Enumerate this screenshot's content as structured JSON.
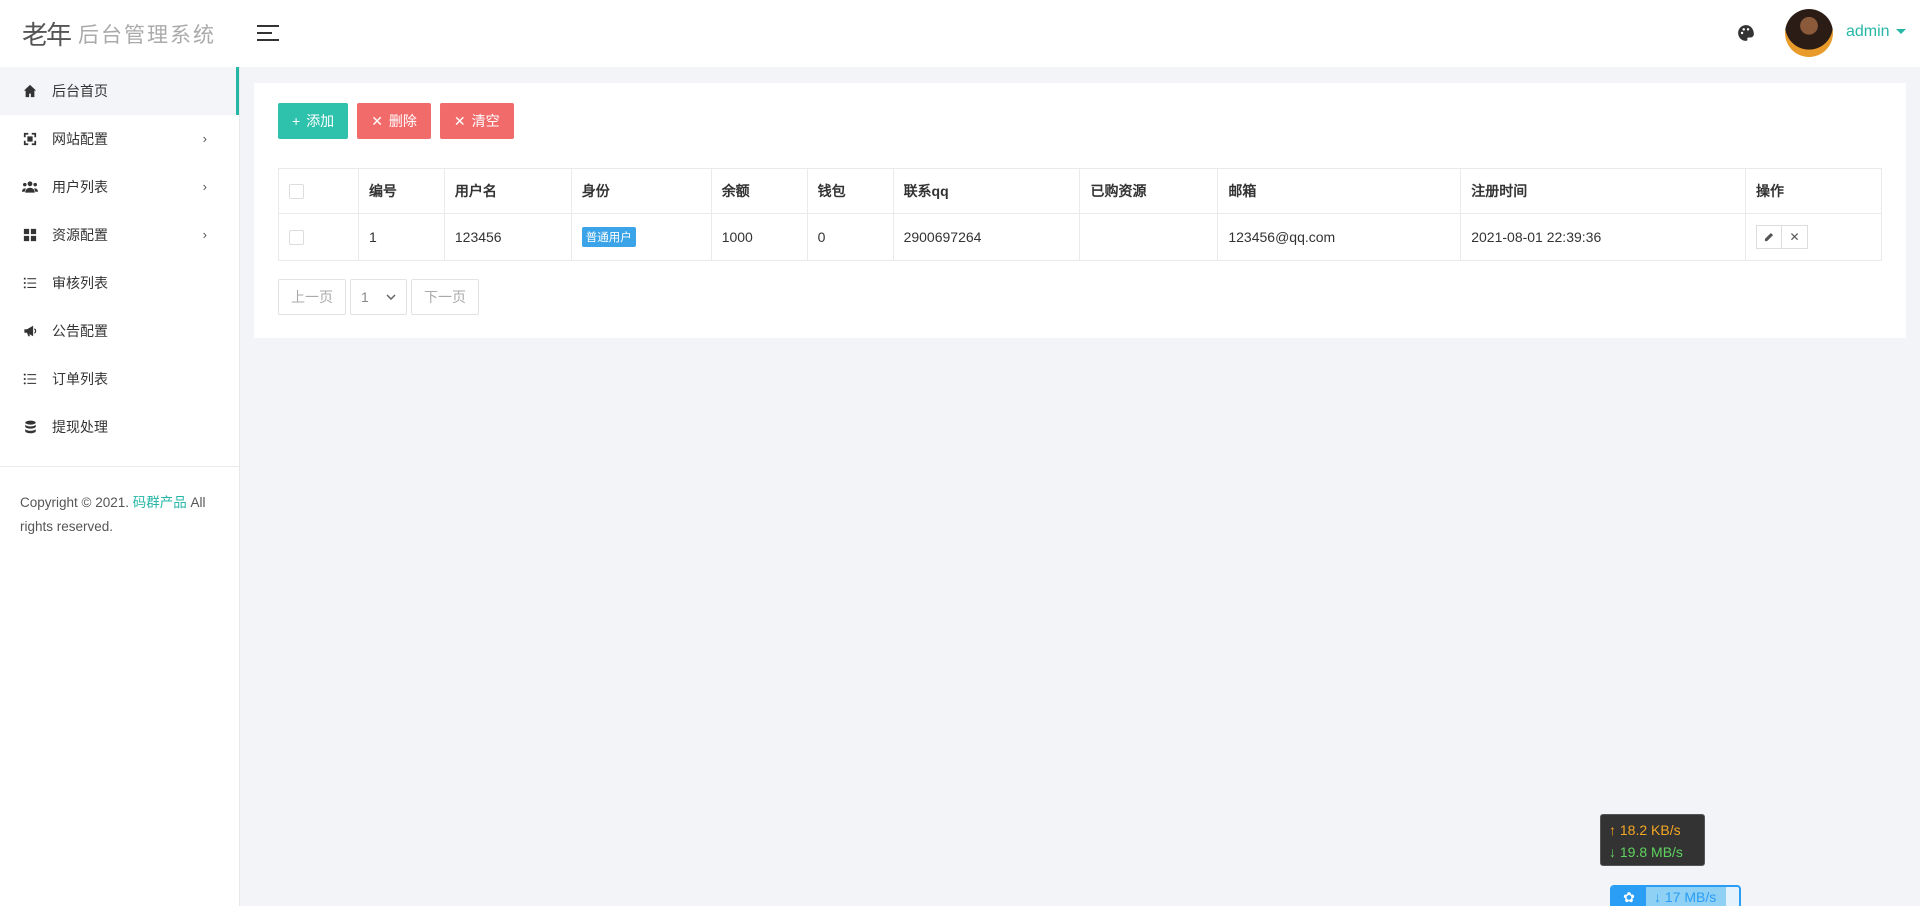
{
  "app": {
    "logo_mark": "老年",
    "title": "后台管理系统"
  },
  "header": {
    "username": "admin"
  },
  "sidebar": {
    "items": [
      {
        "label": "后台首页"
      },
      {
        "label": "网站配置"
      },
      {
        "label": "用户列表"
      },
      {
        "label": "资源配置"
      },
      {
        "label": "审核列表"
      },
      {
        "label": "公告配置"
      },
      {
        "label": "订单列表"
      },
      {
        "label": "提现处理"
      }
    ],
    "copyright_prefix": "Copyright © 2021.",
    "copyright_brand": "码群产品",
    "copyright_suffix": "All rights reserved."
  },
  "toolbar": {
    "add_label": "添加",
    "delete_label": "删除",
    "clear_label": "清空"
  },
  "table": {
    "headers": [
      "编号",
      "用户名",
      "身份",
      "余额",
      "钱包",
      "联系qq",
      "已购资源",
      "邮箱",
      "注册时间",
      "操作"
    ],
    "rows": [
      {
        "id": "1",
        "username": "123456",
        "role": "普通用户",
        "balance": "1000",
        "wallet": "0",
        "qq": "2900697264",
        "purchased": "",
        "email": "123456@qq.com",
        "registered": "2021-08-01 22:39:36"
      }
    ]
  },
  "pager": {
    "prev_label": "上一页",
    "page": "1",
    "next_label": "下一页"
  },
  "netspeed": {
    "up": "↑ 18.2 KB/s",
    "down": "↓ 19.8 MB/s",
    "download_rate": "17 MB/s"
  },
  "colors": {
    "accent": "#26b6a6",
    "add_button": "#2ec1ac",
    "danger_button": "#f26b6b",
    "badge": "#3ba3e8"
  }
}
